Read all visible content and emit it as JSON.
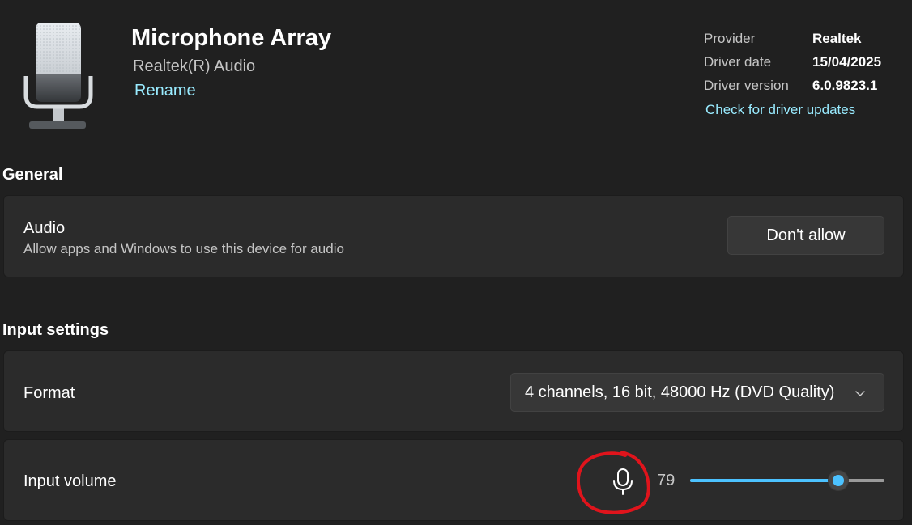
{
  "device": {
    "name": "Microphone Array",
    "subtitle": "Realtek(R) Audio",
    "rename_label": "Rename",
    "image_icon": "microphone-device-icon"
  },
  "driver_info": {
    "provider_label": "Provider",
    "provider_value": "Realtek",
    "date_label": "Driver date",
    "date_value": "15/04/2025",
    "version_label": "Driver version",
    "version_value": "6.0.9823.1",
    "update_link": "Check for driver updates"
  },
  "general": {
    "section_title": "General",
    "audio": {
      "title": "Audio",
      "description": "Allow apps and Windows to use this device for audio",
      "button_label": "Don't allow"
    }
  },
  "input_settings": {
    "section_title": "Input settings",
    "format": {
      "label": "Format",
      "selected": "4 channels, 16 bit, 48000 Hz (DVD Quality)",
      "chevron_icon": "chevron-down-icon"
    },
    "input_volume": {
      "label": "Input volume",
      "value": "79",
      "level": 79,
      "max": 100,
      "mic_icon": "microphone-icon"
    }
  },
  "annotation": {
    "type": "hand-drawn-circle",
    "color": "#e0141c",
    "target": "microphone-icon"
  },
  "colors": {
    "background": "#202020",
    "card": "#2b2b2b",
    "accent": "#4cc2ff",
    "link": "#99ebff"
  }
}
